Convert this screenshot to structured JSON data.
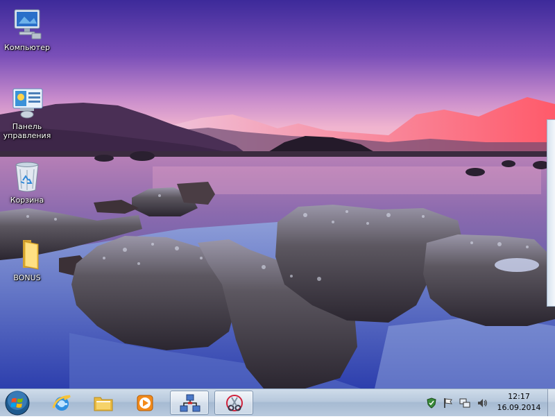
{
  "desktop": {
    "icons": [
      {
        "label": "Компьютер",
        "icon": "computer-icon"
      },
      {
        "label": "Панель\nуправления",
        "icon": "control-panel-icon"
      },
      {
        "label": "Корзина",
        "icon": "recycle-bin-icon"
      },
      {
        "label": "BONUS",
        "icon": "folder-icon"
      }
    ],
    "wallpaper": "frosted-rocks-lake-mountains-sunset"
  },
  "taskbar": {
    "start_icon": "windows-start-orb-icon",
    "pinned": [
      {
        "icon": "internet-explorer-icon",
        "active": false
      },
      {
        "icon": "windows-explorer-folder-icon",
        "active": false
      },
      {
        "icon": "media-player-icon",
        "active": false
      },
      {
        "icon": "network-setup-icon",
        "active": true
      },
      {
        "icon": "scissors-tool-icon",
        "active": true
      }
    ],
    "tray": {
      "icons": [
        "security-shield-icon",
        "action-center-flag-icon",
        "network-icon",
        "volume-icon"
      ],
      "time": "12:17",
      "date": "16.09.2014"
    }
  },
  "colors": {
    "sky_top": "#4a2fa0",
    "sky_horizon": "#e8a0c8",
    "taskbar_bg": "#b7c8dc"
  }
}
